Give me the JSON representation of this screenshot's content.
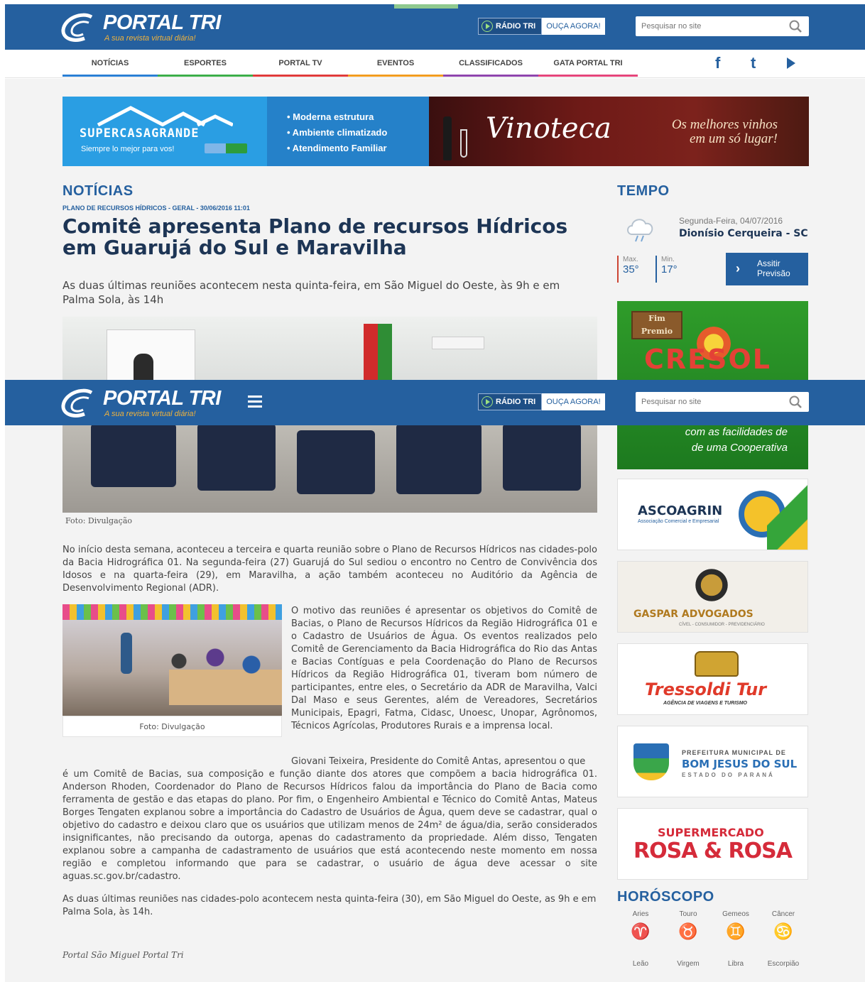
{
  "header": {
    "logo_name": "PORTAL TRI",
    "logo_tagline": "A sua revista virtual diária!",
    "radio_label": "RÁDIO TRI",
    "radio_listen": "OUÇA AGORA!",
    "search_placeholder": "Pesquisar no site"
  },
  "nav": {
    "items": [
      {
        "label": "NOTÍCIAS",
        "color": "#2a7fd4"
      },
      {
        "label": "ESPORTES",
        "color": "#3cae49"
      },
      {
        "label": "PORTAL TV",
        "color": "#e03a3a"
      },
      {
        "label": "EVENTOS",
        "color": "#f29c1f"
      },
      {
        "label": "CLASSIFICADOS",
        "color": "#8e44ad"
      },
      {
        "label": "GATA PORTAL TRI",
        "color": "#e5457a"
      }
    ],
    "social": [
      "facebook-icon",
      "twitter-icon",
      "youtube-icon"
    ]
  },
  "banner": {
    "left_brand": "SUPERCASAGRANDE",
    "left_sub": "Siempre lo mejor para vos!",
    "bullets": [
      "• Moderna estrutura",
      "• Ambiente climatizado",
      "• Atendimento Familiar"
    ],
    "right_brand": "Vinoteca",
    "right_line1": "Os melhores vinhos",
    "right_line2": "em um só lugar!"
  },
  "article": {
    "section": "NOTÍCIAS",
    "meta": "PLANO DE RECURSOS HÍDRICOS - GERAL - 30/06/2016 11:01",
    "title": "Comitê apresenta Plano de recursos Hídricos em Guarujá do Sul e Maravilha",
    "lead": "As duas últimas reuniões acontecem nesta quinta-feira, em São Miguel do Oeste, às 9h e em Palma Sola, às 14h",
    "photo1_caption": "Foto: Divulgação",
    "p1": "No início desta semana, aconteceu a terceira e quarta reunião sobre o Plano de Recursos Hídricos nas cidades-polo da Bacia Hidrográfica 01. Na segunda-feira (27) Guarujá do Sul sediou o encontro no Centro de Convivência dos Idosos e na quarta-feira (29), em Maravilha, a ação também aconteceu no Auditório da Agência de Desenvolvimento Regional (ADR).",
    "photo2_caption": "Foto: Divulgação",
    "p2": "O motivo das reuniões é apresentar os objetivos do Comitê de Bacias, o Plano de Recursos Hídricos da Região Hidrográfica 01 e o Cadastro de Usuários de Água. Os eventos realizados pelo Comitê de Gerenciamento da Bacia Hidrográfica do Rio das Antas e Bacias Contíguas e pela Coordenação do Plano de Recursos Hídricos da Região Hidrográfica 01, tiveram bom número de participantes, entre eles, o Secretário da ADR de Maravilha, Valci Dal Maso e seus Gerentes, além de Vereadores, Secretários Municipais, Epagri, Fatma, Cidasc, Unoesc, Unopar, Agrônomos, Técnicos Agrícolas, Produtores Rurais e a imprensa local.",
    "p3a": "Giovani Teixeira, Presidente do Comitê Antas, apresentou o que",
    "p3b": "é um Comitê de Bacias, sua composição e função diante dos atores que compõem a bacia hidrográfica 01. Anderson Rhoden, Coordenador do Plano de Recursos Hídricos falou da importância do Plano de Bacia como ferramenta de gestão e das etapas do plano. Por fim, o Engenheiro Ambiental e Técnico do Comitê Antas, Mateus Borges Tengaten explanou sobre a importância do Cadastro de Usuários de Água, quem deve se cadastrar, qual o objetivo do cadastro e deixou claro que os usuários que utilizam menos de 24m² de água/dia, serão considerados insignificantes, não precisando da outorga, apenas do cadastramento da propriedade. Além disso, Tengaten explanou sobre a campanha de cadastramento de usuários que está acontecendo neste momento em nossa região e completou informando que para se cadastrar, o usuário de água deve acessar o site aguas.sc.gov.br/cadastro.",
    "p4": "As duas últimas reuniões nas cidades-polo acontecem nesta quinta-feira (30), em São Miguel do Oeste, as 9h e em Palma Sola, às 14h.",
    "signature": "Portal São Miguel Portal Tri"
  },
  "weather": {
    "title": "TEMPO",
    "date": "Segunda-Feira, 04/07/2016",
    "city": "Dionísio Cerqueira - SC",
    "max_label": "Max.",
    "max_value": "35°",
    "min_label": "Min.",
    "min_value": "17°",
    "button": "Assitir Previsão"
  },
  "ads": {
    "cresol_sign": "Fim Premio",
    "cresol": "CRESOL",
    "cresol_tag1": "com as facilidades de",
    "cresol_tag2": "de uma Cooperativa",
    "ascoagrin": "ASCOAGRIN",
    "ascoagrin_sub": "Associação Comercial e Empresarial",
    "gaspar": "GASPAR ADVOGADOS",
    "gaspar_sub": "CÍVEL - CONSUMIDOR - PREVIDENCIÁRIO",
    "tressoldi": "Tressoldi Tur",
    "tressoldi_sub": "AGÊNCIA DE VIAGENS E TURISMO",
    "bomjesus_1": "PREFEITURA MUNICIPAL DE",
    "bomjesus_2": "BOM JESUS DO SUL",
    "bomjesus_3": "ESTADO DO PARANÁ",
    "rosa_1": "SUPERMERCADO",
    "rosa_2": "ROSA & ROSA"
  },
  "horoscope": {
    "title": "HORÓSCOPO",
    "row1": [
      "Aries",
      "Touro",
      "Gemeos",
      "Câncer"
    ],
    "row2": [
      "Leão",
      "Virgem",
      "Libra",
      "Escorpião"
    ]
  },
  "sticky": {
    "logo_name": "PORTAL TRI",
    "logo_tagline": "A sua revista virtual diária!",
    "radio_label": "RÁDIO TRI",
    "radio_listen": "OUÇA AGORA!",
    "search_placeholder": "Pesquisar no site"
  }
}
